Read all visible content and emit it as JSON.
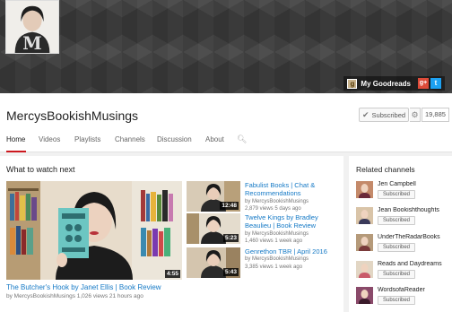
{
  "banner": {
    "goodreads_label": "My Goodreads",
    "gplus_icon": "g+",
    "twitter_icon": "t"
  },
  "header": {
    "channel_title": "MercysBookishMusings",
    "subscribe_label": "Subscribed",
    "subscriber_count": "19,885",
    "tabs": [
      {
        "label": "Home"
      },
      {
        "label": "Videos"
      },
      {
        "label": "Playlists"
      },
      {
        "label": "Channels"
      },
      {
        "label": "Discussion"
      },
      {
        "label": "About"
      }
    ],
    "active_tab": "Home"
  },
  "main": {
    "section_title": "What to watch next",
    "featured": {
      "duration": "4:55",
      "title": "The Butcher's Hook by Janet Ellis | Book Review",
      "meta": "by MercysBookishMusings  1,026 views  21 hours ago"
    },
    "videos": [
      {
        "title": "Fabulist Books | Chat & Recommendations",
        "duration": "12:48",
        "by": "by MercysBookishMusings",
        "stats": "2,879 views  5 days ago"
      },
      {
        "title": "Twelve Kings by Bradley Beaulieu | Book Review",
        "duration": "5:23",
        "by": "by MercysBookishMusings",
        "stats": "1,460 views  1 week ago"
      },
      {
        "title": "Genrethon TBR | April 2016",
        "duration": "5:43",
        "by": "by MercysBookishMusings",
        "stats": "3,385 views  1 week ago"
      }
    ]
  },
  "sidebar": {
    "title": "Related channels",
    "items": [
      {
        "name": "Jen Campbell",
        "sub_label": "Subscribed"
      },
      {
        "name": "Jean Bookishthoughts",
        "sub_label": "Subscribed"
      },
      {
        "name": "UnderTheRadarBooks",
        "sub_label": "Subscribed"
      },
      {
        "name": "Reads and Daydreams",
        "sub_label": "Subscribed"
      },
      {
        "name": "WordsofaReader",
        "sub_label": "Subscribed"
      }
    ]
  },
  "colors": {
    "link": "#167ac6",
    "active_tab_underline": "#cc181e",
    "banner": "#3a3a3a"
  }
}
